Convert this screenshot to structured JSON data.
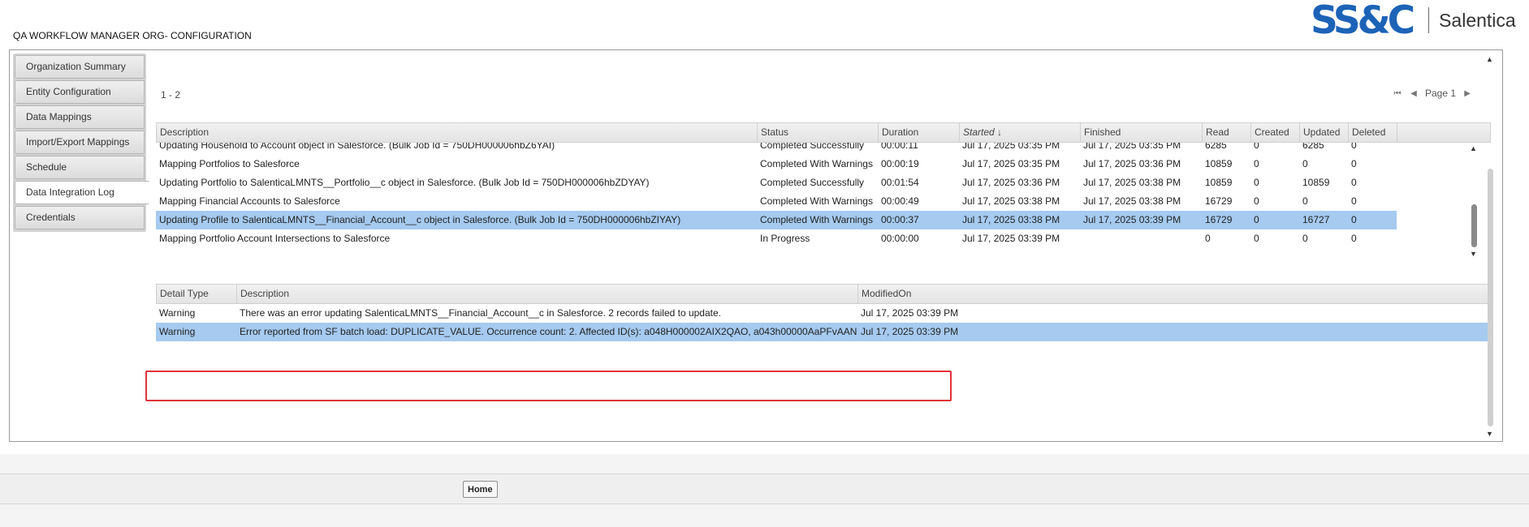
{
  "header": {
    "title": "QA WORKFLOW MANAGER ORG- CONFIGURATION"
  },
  "logo": {
    "mark": "SS&C",
    "text": "Salentica"
  },
  "nav": {
    "tabs": [
      {
        "label": "Organization Summary"
      },
      {
        "label": "Entity Configuration"
      },
      {
        "label": "Data Mappings"
      },
      {
        "label": "Import/Export Mappings"
      },
      {
        "label": "Schedule"
      },
      {
        "label": "Data Integration Log"
      },
      {
        "label": "Credentials"
      }
    ],
    "active_index": 5
  },
  "pager": {
    "range": "1 - 2",
    "page_label": "Page 1"
  },
  "log_table": {
    "columns": [
      "Description",
      "Status",
      "Duration",
      "Started",
      "Finished",
      "Read",
      "Created",
      "Updated",
      "Deleted"
    ],
    "sort_indicator": "↓",
    "rows": [
      {
        "description": "Updating Household to Account object in Salesforce. (Bulk Job Id = 750DH000006hbZ6YAI)",
        "status": "Completed Successfully",
        "duration": "00:00:11",
        "started": "Jul 17, 2025 03:35 PM",
        "finished": "Jul 17, 2025 03:35 PM",
        "read": "6285",
        "created": "0",
        "updated": "6285",
        "deleted": "0",
        "selected": false
      },
      {
        "description": "Mapping Portfolios to Salesforce",
        "status": "Completed With Warnings",
        "duration": "00:00:19",
        "started": "Jul 17, 2025 03:35 PM",
        "finished": "Jul 17, 2025 03:36 PM",
        "read": "10859",
        "created": "0",
        "updated": "0",
        "deleted": "0",
        "selected": false
      },
      {
        "description": "Updating Portfolio to SalenticaLMNTS__Portfolio__c object in Salesforce. (Bulk Job Id = 750DH000006hbZDYAY)",
        "status": "Completed Successfully",
        "duration": "00:01:54",
        "started": "Jul 17, 2025 03:36 PM",
        "finished": "Jul 17, 2025 03:38 PM",
        "read": "10859",
        "created": "0",
        "updated": "10859",
        "deleted": "0",
        "selected": false
      },
      {
        "description": "Mapping Financial Accounts to Salesforce",
        "status": "Completed With Warnings",
        "duration": "00:00:49",
        "started": "Jul 17, 2025 03:38 PM",
        "finished": "Jul 17, 2025 03:38 PM",
        "read": "16729",
        "created": "0",
        "updated": "0",
        "deleted": "0",
        "selected": false
      },
      {
        "description": "Updating Profile to SalenticaLMNTS__Financial_Account__c object in Salesforce. (Bulk Job Id = 750DH000006hbZIYAY)",
        "status": "Completed With Warnings",
        "duration": "00:00:37",
        "started": "Jul 17, 2025 03:38 PM",
        "finished": "Jul 17, 2025 03:39 PM",
        "read": "16729",
        "created": "0",
        "updated": "16727",
        "deleted": "0",
        "selected": true
      },
      {
        "description": "Mapping Portfolio Account Intersections to Salesforce",
        "status": "In Progress",
        "duration": "00:00:00",
        "started": "Jul 17, 2025 03:39 PM",
        "finished": "",
        "read": "0",
        "created": "0",
        "updated": "0",
        "deleted": "0",
        "selected": false
      }
    ]
  },
  "detail_table": {
    "columns": [
      "Detail Type",
      "Description",
      "ModifiedOn"
    ],
    "rows": [
      {
        "type": "Warning",
        "description": "There was an error updating SalenticaLMNTS__Financial_Account__c in Salesforce. 2 records failed to update.",
        "modified": "Jul 17, 2025 03:39 PM",
        "selected": false
      },
      {
        "type": "Warning",
        "description": "Error reported from SF batch load: DUPLICATE_VALUE. Occurrence count: 2. Affected ID(s): a048H000002AIX2QAO, a043h00000AaPFvAAN",
        "modified": "Jul 17, 2025 03:39 PM",
        "selected": true
      }
    ]
  },
  "footer": {
    "home_label": "Home"
  },
  "colors": {
    "selected_row": "#a6caf0",
    "highlight_border": "#e0323a",
    "logo_blue": "#1c63b7"
  }
}
